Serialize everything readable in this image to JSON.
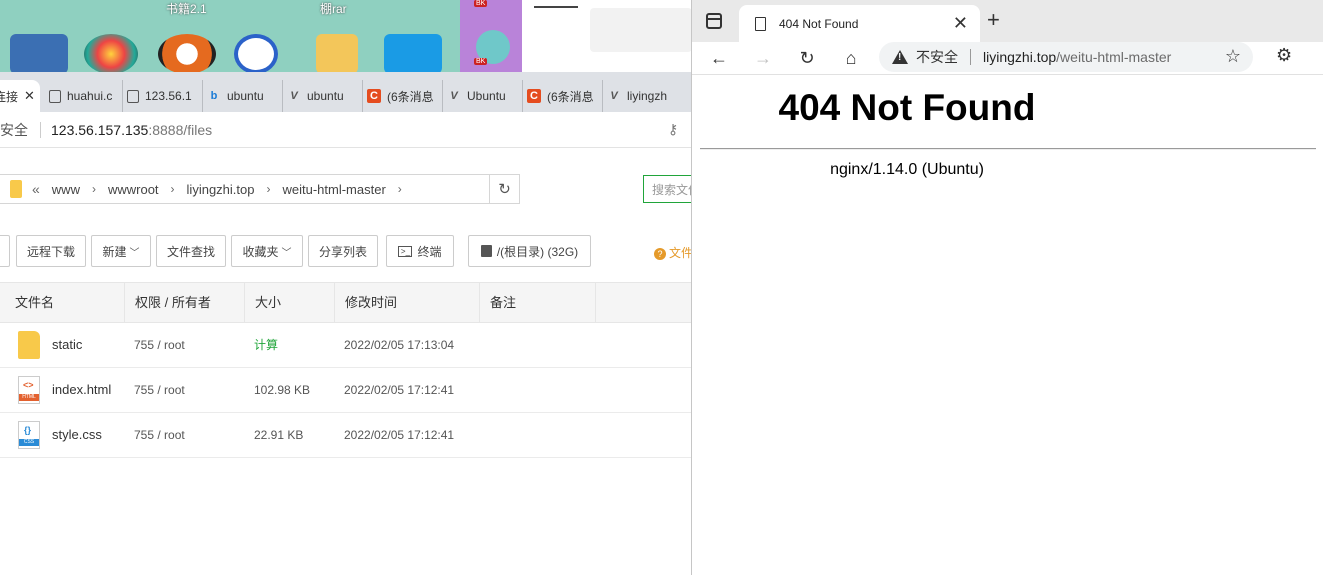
{
  "desktop": {
    "labels": [
      "书籍2.1",
      "棚rar"
    ],
    "badges": [
      "BK",
      "BK"
    ]
  },
  "left_browser": {
    "tabs": [
      {
        "label": "连接",
        "favicon": "doc-icon"
      },
      {
        "label": "huahui.c",
        "favicon": "doc-icon"
      },
      {
        "label": "123.56.1",
        "favicon": "doc-icon"
      },
      {
        "label": "ubuntu",
        "favicon": "bing-icon"
      },
      {
        "label": "ubuntu",
        "favicon": "u-icon"
      },
      {
        "label": "(6条消息",
        "favicon": "csdn-icon"
      },
      {
        "label": "Ubuntu",
        "favicon": "u-icon"
      },
      {
        "label": "(6条消息",
        "favicon": "csdn-icon"
      },
      {
        "label": "liyingzh",
        "favicon": "u-icon"
      }
    ],
    "address": {
      "security": "安全",
      "host": "123.56.157.135",
      "path": ":8888/files"
    },
    "breadcrumb": [
      "www",
      "wwwroot",
      "liyingzhi.top",
      "weitu-html-master"
    ],
    "search_placeholder": "搜索文件",
    "toolbar": {
      "remote_download": "远程下载",
      "new": "新建",
      "file_search": "文件查找",
      "favorites": "收藏夹",
      "share_list": "分享列表",
      "terminal": "终端",
      "disk": "/(根目录) (32G)",
      "doc_hint": "文件"
    },
    "table": {
      "headers": [
        "文件名",
        "权限 / 所有者",
        "大小",
        "修改时间",
        "备注"
      ],
      "rows": [
        {
          "type": "folder",
          "name": "static",
          "perm": "755 / root",
          "size": "计算",
          "mtime": "2022/02/05 17:13:04"
        },
        {
          "type": "html",
          "name": "index.html",
          "perm": "755 / root",
          "size": "102.98 KB",
          "mtime": "2022/02/05 17:12:41"
        },
        {
          "type": "css",
          "name": "style.css",
          "perm": "755 / root",
          "size": "22.91 KB",
          "mtime": "2022/02/05 17:12:41"
        }
      ]
    }
  },
  "right_browser": {
    "tab_title": "404 Not Found",
    "address": {
      "security": "不安全",
      "host": "liyingzhi.top",
      "path": "/weitu-html-master"
    },
    "page": {
      "heading": "404 Not Found",
      "server": "nginx/1.14.0 (Ubuntu)"
    }
  }
}
